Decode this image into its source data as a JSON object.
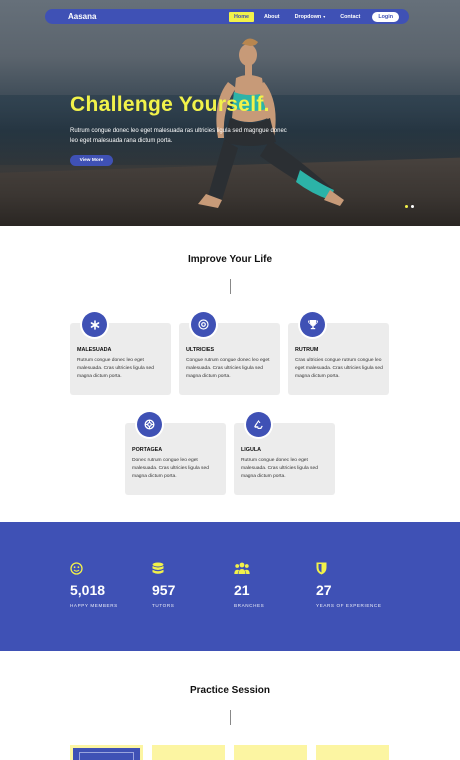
{
  "navbar": {
    "brand": "Aasana",
    "links": [
      {
        "label": "Home",
        "active": true
      },
      {
        "label": "About"
      },
      {
        "label": "Dropdown",
        "caret": "▾"
      },
      {
        "label": "Contact"
      }
    ],
    "login_label": "Login"
  },
  "hero": {
    "title": "Challenge Yourself.",
    "text": "Rutrum congue donec leo eget malesuada ras ultricies ligula sed magngue donec leo eget malesuada rana dictum porta.",
    "button_label": "View More"
  },
  "improve": {
    "title": "Improve Your Life",
    "cards": [
      {
        "icon": "asterisk-icon",
        "title": "MALESUADA",
        "text": "Rutrum congue donec leo eget malesuada. Cras ultricies ligula sed magna dictum porta."
      },
      {
        "icon": "at-sign-icon",
        "title": "ULTRICIES",
        "text": "Congue rutrum congue donec leo eget malesuada. Cras ultricies ligula sed magna dictum porta."
      },
      {
        "icon": "trophy-icon",
        "title": "RUTRUM",
        "text": "Cras ultricies congue rutrum congue leo eget malesuada. Cras ultricies ligula sed magna dictum porta."
      },
      {
        "icon": "lifebuoy-icon",
        "title": "PORTAGEA",
        "text": "Donec rutrum congue leo eget malesuada. Cras ultricies ligula sed magna dictum porta."
      },
      {
        "icon": "recycle-icon",
        "title": "LIGULA",
        "text": "Rutrum congue donec leo eget malesuada. Cras ultricies ligula sed magna dictum porta."
      }
    ]
  },
  "stats": [
    {
      "icon": "smiley-icon",
      "value": "5,018",
      "label": "HAPPY MEMBERS"
    },
    {
      "icon": "database-icon",
      "value": "957",
      "label": "TUTORS"
    },
    {
      "icon": "users-icon",
      "value": "21",
      "label": "BRANCHES"
    },
    {
      "icon": "shield-icon",
      "value": "27",
      "label": "YEARS OF EXPERIENCE"
    }
  ],
  "practice": {
    "title": "Practice Session"
  },
  "colors": {
    "primary": "#3f51b5",
    "accent": "#f2f24a",
    "card_bg": "#ececec",
    "practice_card": "#fcf5a2"
  }
}
